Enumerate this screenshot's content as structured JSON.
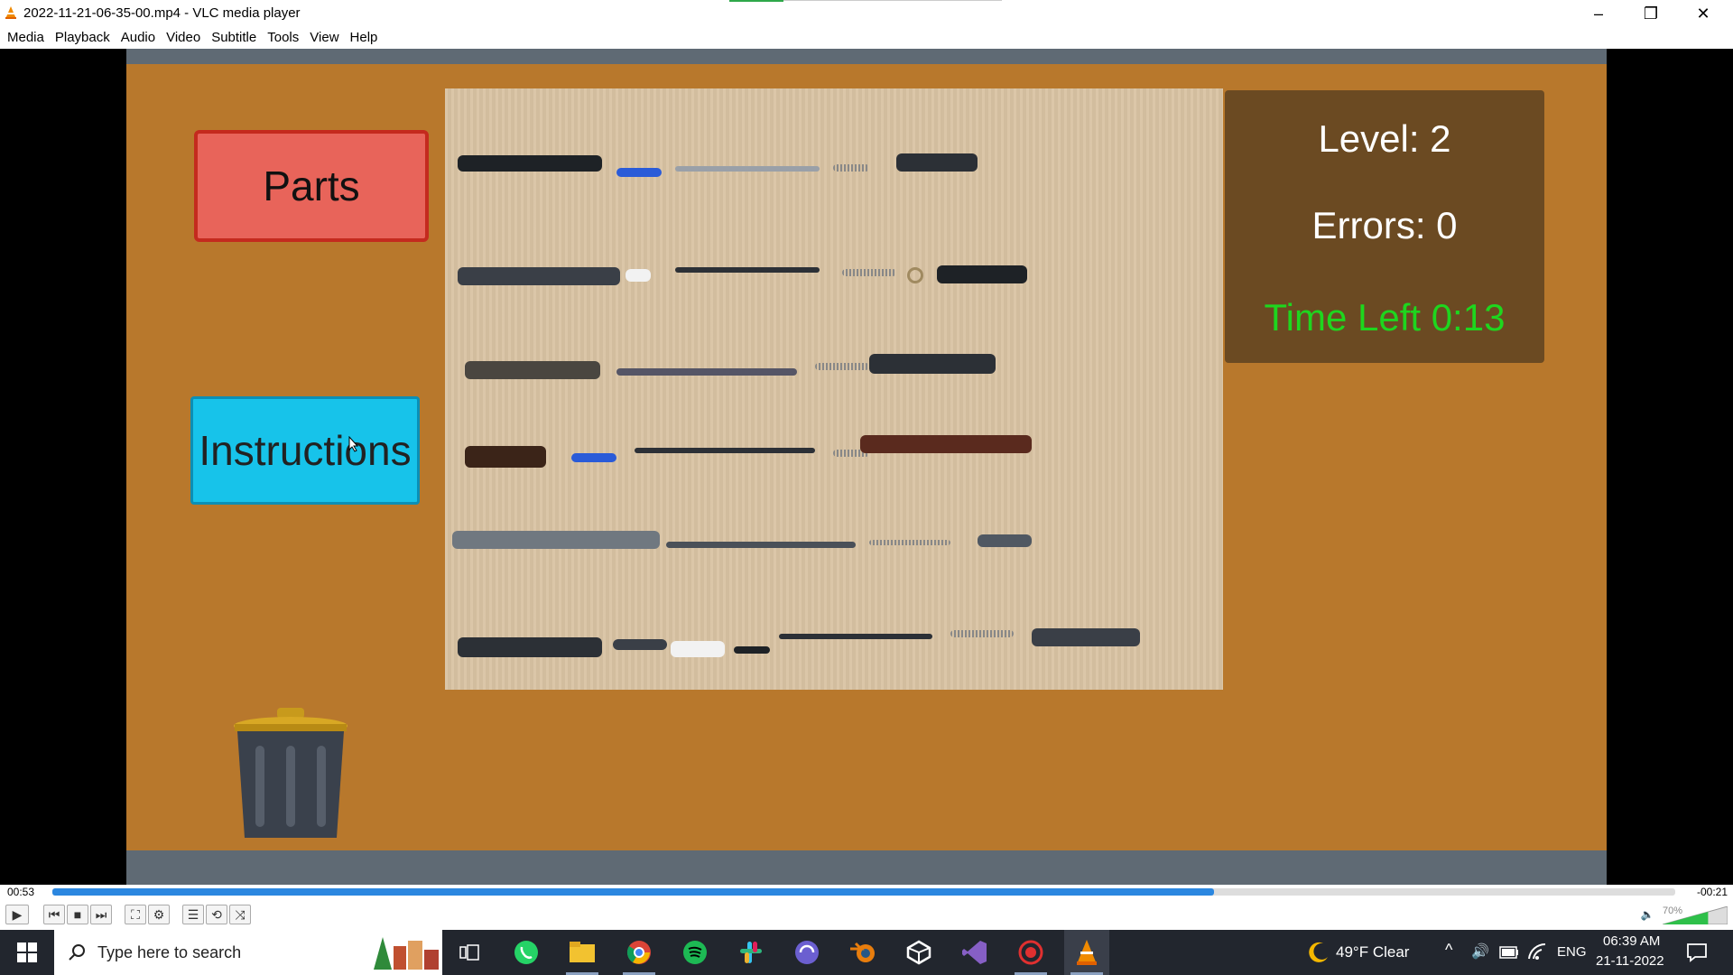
{
  "window": {
    "title": "2022-11-21-06-35-00.mp4 - VLC media player",
    "minimize": "–",
    "restore": "❐",
    "close": "✕"
  },
  "menu": [
    "Media",
    "Playback",
    "Audio",
    "Video",
    "Subtitle",
    "Tools",
    "View",
    "Help"
  ],
  "game": {
    "parts_label": "Parts",
    "instructions_label": "Instructions",
    "level": "Level: 2",
    "errors": "Errors: 0",
    "time_left": "Time Left  0:13",
    "time_color": "#1ed61e",
    "background_color": "#b8782c"
  },
  "player": {
    "elapsed": "00:53",
    "remaining": "-00:21",
    "progress": 0.716,
    "volume": "70%",
    "volume_level": 0.7
  },
  "taskbar": {
    "search_placeholder": "Type here to search",
    "weather": "49°F  Clear",
    "language": "ENG",
    "time": "06:39 AM",
    "date": "21-11-2022"
  }
}
